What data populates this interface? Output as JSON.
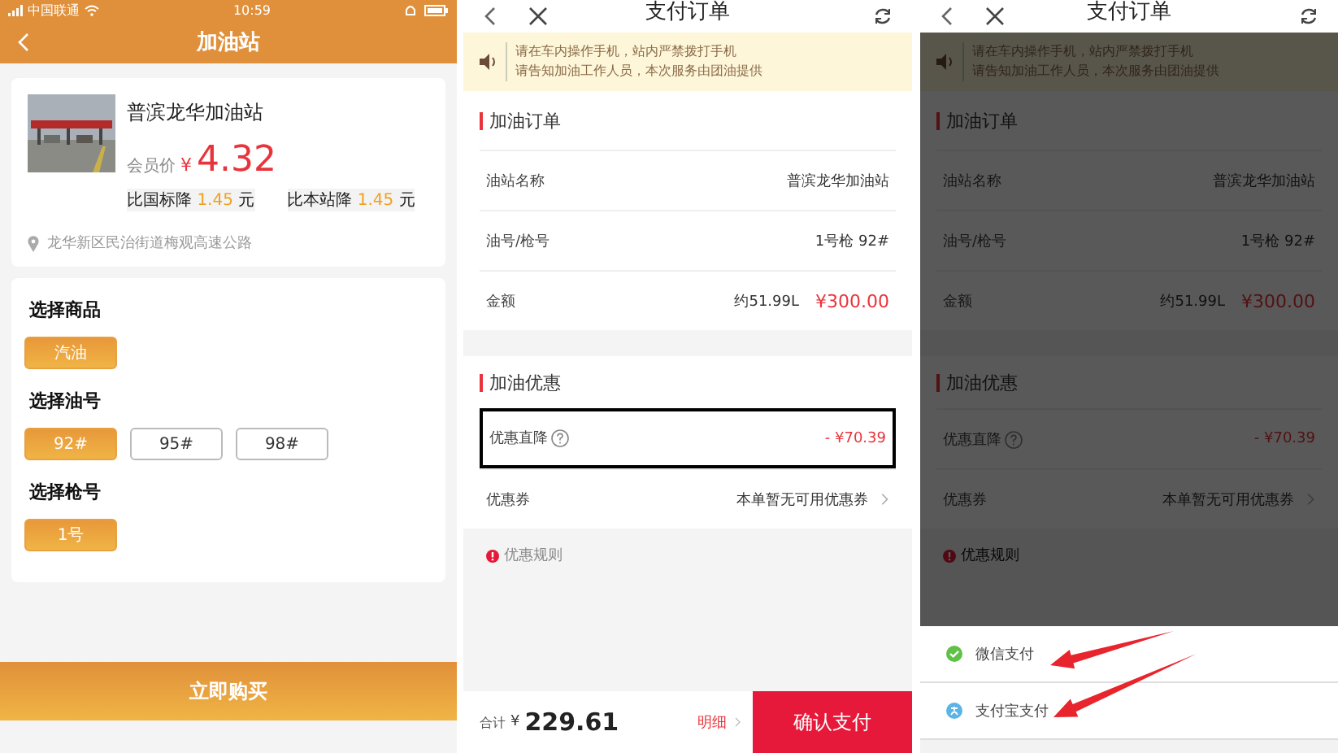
{
  "station_screen": {
    "status_bar": {
      "carrier": "中国联通",
      "time": "10:59"
    },
    "nav": {
      "title": "加油站"
    },
    "station": {
      "name": "普滨龙华加油站",
      "price_label": "会员价",
      "currency": "¥",
      "price": "4.32",
      "address": "龙华新区民治街道梅观高速公路",
      "discounts": [
        {
          "label": "比国标降",
          "amount": "1.45",
          "unit": "元"
        },
        {
          "label": "比本站降",
          "amount": "1.45",
          "unit": "元"
        }
      ]
    },
    "option_groups": [
      {
        "title": "选择商品",
        "options": [
          {
            "label": "汽油",
            "selected": true
          }
        ]
      },
      {
        "title": "选择油号",
        "options": [
          {
            "label": "92#",
            "selected": true
          },
          {
            "label": "95#",
            "selected": false
          },
          {
            "label": "98#",
            "selected": false
          }
        ]
      },
      {
        "title": "选择枪号",
        "options": [
          {
            "label": "1号",
            "selected": true
          }
        ]
      }
    ],
    "buy_button": "立即购买"
  },
  "order_screens": [
    {
      "dimmed": false,
      "title": "支付订单",
      "notice": [
        "请在车内操作手机，站内严禁拨打手机",
        "请告知加油工作人员，本次服务由团油提供"
      ],
      "order_section": {
        "title": "加油订单",
        "rows": [
          {
            "label": "油站名称",
            "value": "普滨龙华加油站"
          },
          {
            "label": "油号/枪号",
            "value": "1号枪 92#"
          },
          {
            "label": "金额",
            "note": "约51.99L",
            "value": "¥300.00"
          }
        ]
      },
      "discount_section": {
        "title": "加油优惠",
        "rows": [
          {
            "kind": "direct",
            "label": "优惠直降",
            "value": "- ¥70.39",
            "highlighted": true
          },
          {
            "kind": "coupon",
            "label": "优惠券",
            "value": "本单暂无可用优惠券",
            "highlighted": false
          }
        ]
      },
      "rules_link": "优惠规则",
      "footer": {
        "total_label": "合计",
        "currency": "¥",
        "total": "229.61",
        "detail": "明细",
        "confirm": "确认支付"
      }
    },
    {
      "dimmed": true,
      "title": "支付订单",
      "notice": [
        "请在车内操作手机，站内严禁拨打手机",
        "请告知加油工作人员，本次服务由团油提供"
      ],
      "order_section": {
        "title": "加油订单",
        "rows": [
          {
            "label": "油站名称",
            "value": "普滨龙华加油站"
          },
          {
            "label": "油号/枪号",
            "value": "1号枪 92#"
          },
          {
            "label": "金额",
            "note": "约51.99L",
            "value": "¥300.00"
          }
        ]
      },
      "discount_section": {
        "title": "加油优惠",
        "rows": [
          {
            "kind": "direct",
            "label": "优惠直降",
            "value": "- ¥70.39",
            "highlighted": false
          },
          {
            "kind": "coupon",
            "label": "优惠券",
            "value": "本单暂无可用优惠券",
            "highlighted": false
          }
        ]
      },
      "rules_link": "优惠规则",
      "payment_sheet": {
        "options": [
          {
            "kind": "wechat",
            "label": "微信支付",
            "annotated": true
          },
          {
            "kind": "alipay",
            "label": "支付宝支付",
            "annotated": true
          }
        ]
      }
    }
  ]
}
